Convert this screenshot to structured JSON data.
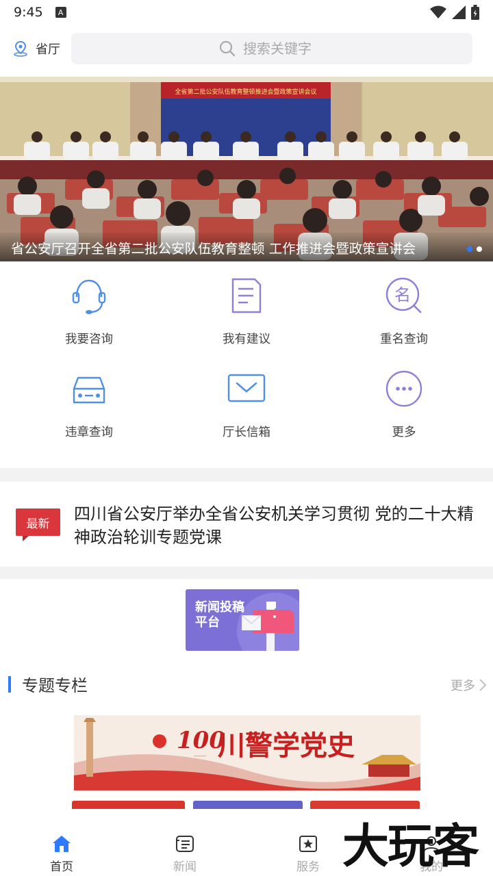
{
  "status_bar": {
    "time": "9:45",
    "badge": "A"
  },
  "header": {
    "location_label": "省厅",
    "search_placeholder": "搜索关键字"
  },
  "banner": {
    "caption": "省公安厅召开全省第二批公安队伍教育整顿 工作推进会暨政策宣讲会",
    "backdrop_text": "全省第二批公安队伍教育整顿推进会暨政策宣讲会议",
    "slide_count": 2,
    "active_slide": 1
  },
  "quick_actions": [
    {
      "label": "我要咨询",
      "icon": "headset-icon"
    },
    {
      "label": "我有建议",
      "icon": "document-icon"
    },
    {
      "label": "重名查询",
      "icon": "name-search-icon"
    },
    {
      "label": "违章查询",
      "icon": "car-icon"
    },
    {
      "label": "厅长信箱",
      "icon": "mail-icon"
    },
    {
      "label": "更多",
      "icon": "more-icon"
    }
  ],
  "latest": {
    "tag": "最新",
    "headline": "四川省公安厅举办全省公安机关学习贯彻 党的二十大精神政治轮训专题党课"
  },
  "submission": {
    "label": "新闻投稿平台",
    "line1": "新闻投稿",
    "line2": "平台"
  },
  "special": {
    "title": "专题专栏",
    "more": "更多",
    "banner_text": "川警学党史",
    "banner_badge": "100"
  },
  "nav": [
    {
      "label": "首页",
      "icon": "home-icon",
      "active": true
    },
    {
      "label": "新闻",
      "icon": "news-icon",
      "active": false
    },
    {
      "label": "服务",
      "icon": "service-icon",
      "active": false
    },
    {
      "label": "我的",
      "icon": "profile-icon",
      "active": false
    }
  ],
  "watermark": "大玩客",
  "colors": {
    "accent": "#2f7bff",
    "latest_red": "#d9373b",
    "submit_purple": "#7c6fd6",
    "icon_blue": "#4f8fe6",
    "icon_purple": "#8b7fd9"
  }
}
